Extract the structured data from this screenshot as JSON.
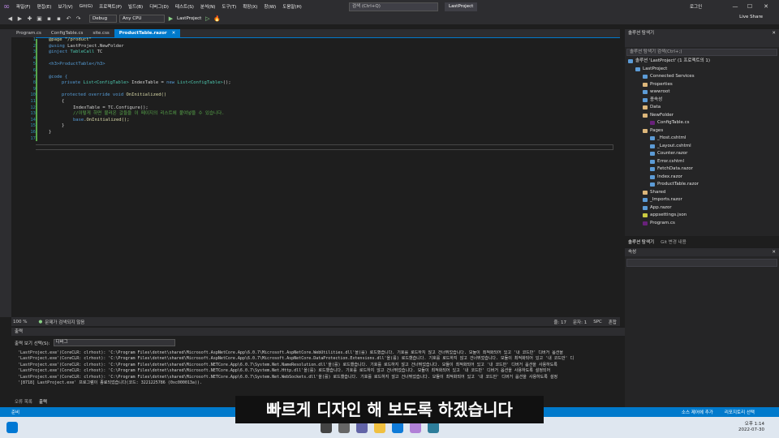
{
  "menu": [
    "파일(F)",
    "편집(E)",
    "보기(V)",
    "Git(G)",
    "프로젝트(P)",
    "빌드(B)",
    "디버그(D)",
    "테스트(S)",
    "분석(N)",
    "도구(T)",
    "확장(X)",
    "창(W)",
    "도움말(H)"
  ],
  "search_placeholder": "검색 (Ctrl+Q)",
  "project_badge": "LastProject",
  "login": "로그인",
  "toolbar": {
    "config": "Debug",
    "platform": "Any CPU",
    "run_label": "LastProject",
    "live_share": "Live Share"
  },
  "tabs": [
    {
      "label": "Program.cs",
      "active": false
    },
    {
      "label": "ConfigTable.cs",
      "active": false
    },
    {
      "label": "site.css",
      "active": false
    },
    {
      "label": "ProductTable.razor",
      "active": true
    }
  ],
  "code": {
    "line_numbers": [
      "1",
      "2",
      "3",
      "4",
      "5",
      "6",
      "7",
      "8",
      "9",
      "10",
      "11",
      "12",
      "13",
      "14",
      "15",
      "16",
      "17"
    ],
    "l1": "@page \"/product\"",
    "l2a": "@using",
    "l2b": " LastProject.NewFolder",
    "l3a": "@inject",
    "l3b": " TableCall",
    "l3c": " TC",
    "l5": "<h3>ProductTable</h3>",
    "l7": "@code {",
    "l8a": "private",
    "l8b": " List",
    "l8c": "<ConfigTable>",
    "l8d": " IndexTable = ",
    "l8e": "new",
    "l8f": " List",
    "l8g": "<ConfigTable>",
    "l8h": "();",
    "l10a": "protected override void",
    "l10b": " OnInitialized()",
    "l11": "{",
    "l12": "IndexTable = TC.Configure();",
    "l13": "//이렇게 하면 불러온 값들을 이 페이지의 리스트에 붙여넣을 수 있습니다.",
    "l14a": "base",
    "l14b": ".OnInitialized();",
    "l15": "}",
    "l16": "}"
  },
  "editor_status": {
    "zoom": "100 %",
    "issues": "문제가 검색되지 않음",
    "line": "줄: 17",
    "char": "문자: 1",
    "spc": "SPC",
    "crlf": "혼합"
  },
  "solution_explorer": {
    "title": "솔루션 탐색기",
    "search": "솔루션 탐색기 검색(Ctrl+;)",
    "items": [
      {
        "label": "솔루션 'LastProject' (1 프로젝트의 1)",
        "indent": 0,
        "icon": "solution-icon"
      },
      {
        "label": "LastProject",
        "indent": 1,
        "icon": "project-icon"
      },
      {
        "label": "Connected Services",
        "indent": 2,
        "icon": "connected-services-icon"
      },
      {
        "label": "Properties",
        "indent": 2,
        "icon": "folder-icon"
      },
      {
        "label": "wwwroot",
        "indent": 2,
        "icon": "globe-icon"
      },
      {
        "label": "종속성",
        "indent": 2,
        "icon": "dependencies-icon"
      },
      {
        "label": "Data",
        "indent": 2,
        "icon": "folder-icon"
      },
      {
        "label": "NewFolder",
        "indent": 2,
        "icon": "folder-icon"
      },
      {
        "label": "ConfigTable.cs",
        "indent": 3,
        "icon": "csharp-file-icon"
      },
      {
        "label": "Pages",
        "indent": 2,
        "icon": "folder-icon"
      },
      {
        "label": "_Host.cshtml",
        "indent": 3,
        "icon": "razor-file-icon"
      },
      {
        "label": "_Layout.cshtml",
        "indent": 3,
        "icon": "razor-file-icon"
      },
      {
        "label": "Counter.razor",
        "indent": 3,
        "icon": "razor-file-icon"
      },
      {
        "label": "Error.cshtml",
        "indent": 3,
        "icon": "razor-file-icon"
      },
      {
        "label": "FetchData.razor",
        "indent": 3,
        "icon": "razor-file-icon"
      },
      {
        "label": "Index.razor",
        "indent": 3,
        "icon": "razor-file-icon"
      },
      {
        "label": "ProductTable.razor",
        "indent": 3,
        "icon": "razor-file-icon"
      },
      {
        "label": "Shared",
        "indent": 2,
        "icon": "folder-icon"
      },
      {
        "label": "_Imports.razor",
        "indent": 2,
        "icon": "razor-file-icon"
      },
      {
        "label": "App.razor",
        "indent": 2,
        "icon": "razor-file-icon"
      },
      {
        "label": "appsettings.json",
        "indent": 2,
        "icon": "json-file-icon"
      },
      {
        "label": "Program.cs",
        "indent": 2,
        "icon": "csharp-file-icon"
      }
    ],
    "bottom_tabs": [
      "솔루션 탐색기",
      "Git 변경 내용"
    ]
  },
  "properties_title": "속성",
  "output": {
    "title": "출력",
    "source_label": "출력 보기 선택(S):",
    "source_value": "디버그",
    "lines": [
      "'LastProject.exe'(CoreCLR: clrhost): 'C:\\Program Files\\dotnet\\shared\\Microsoft.AspNetCore.App\\6.0.7\\Microsoft.AspNetCore.WebUtilities.dll'을(를) 로드했습니다. 기호를 로드하지 않고 건너뛰었습니다. 모듈이 최적화되어 있고 '내 코드만' 디버거 옵션을",
      "'LastProject.exe'(CoreCLR: clrhost): 'C:\\Program Files\\dotnet\\shared\\Microsoft.AspNetCore.App\\6.0.7\\Microsoft.AspNetCore.DataProtection.Extensions.dll'을(를) 로드했습니다. 기호를 로드하지 않고 건너뛰었습니다. 모듈이 최적화되어 있고 '내 코드만' 디",
      "'LastProject.exe'(CoreCLR: clrhost): 'C:\\Program Files\\dotnet\\shared\\Microsoft.NETCore.App\\6.0.7\\System.Net.NameResolution.dll'을(를) 로드했습니다. 기호를 로드하지 않고 건너뛰었습니다. 모듈이 최적화되어 있고 '내 코드만' 디버거 옵션을 사용하도록",
      "'LastProject.exe'(CoreCLR: clrhost): 'C:\\Program Files\\dotnet\\shared\\Microsoft.NETCore.App\\6.0.7\\System.Net.Http.dll'을(를) 로드했습니다. 기호를 로드하지 않고 건너뛰었습니다. 모듈이 최적화되어 있고 '내 코드만' 디버거 옵션을 사용하도록 설정되어",
      "'LastProject.exe'(CoreCLR: clrhost): 'C:\\Program Files\\dotnet\\shared\\Microsoft.NETCore.App\\6.0.7\\System.Net.WebSockets.dll'을(를) 로드했습니다. 기호를 로드하지 않고 건너뛰었습니다. 모듈이 최적화되어 있고 '내 코드만' 디버거 옵션을 사용하도록 설정",
      "'[8718] LastProject.exe' 프로그램이 종료되었습니다(코드: 3221225786 (0xc000013a))."
    ],
    "bottom_tabs": [
      "오류 목록",
      "출력"
    ]
  },
  "status_bar": {
    "ready": "준비",
    "source_control": "소스 제어에 추가",
    "repo": "리포지토리 선택"
  },
  "taskbar": {
    "time": "오후 1:14",
    "date": "2022-07-30"
  },
  "subtitle": "빠르게 디자인 해 보도록 하겠습니다"
}
